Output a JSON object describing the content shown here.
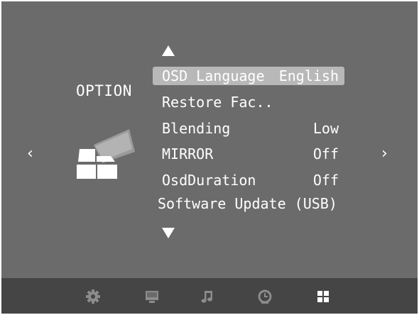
{
  "osd": {
    "section_title": "OPTION",
    "section_icon": "option-icon",
    "left_arrow": "‹",
    "right_arrow": "›",
    "scroll_up_icon": "triangle-up-icon",
    "scroll_down_icon": "triangle-down-icon"
  },
  "menu": {
    "items": [
      {
        "label": "OSD Language",
        "value": "English",
        "selected": true
      },
      {
        "label": "Restore Fac..",
        "value": "",
        "selected": false
      },
      {
        "label": "Blending",
        "value": "Low",
        "selected": false
      },
      {
        "label": "MIRROR",
        "value": "Off",
        "selected": false
      },
      {
        "label": "OsdDuration",
        "value": "Off",
        "selected": false
      },
      {
        "label": "Software Update (USB)",
        "value": "",
        "selected": false
      }
    ]
  },
  "tabs": [
    {
      "name": "settings",
      "icon": "gear-icon",
      "active": false
    },
    {
      "name": "picture",
      "icon": "monitor-icon",
      "active": false
    },
    {
      "name": "sound",
      "icon": "music-note-icon",
      "active": false
    },
    {
      "name": "time",
      "icon": "clock-icon",
      "active": false
    },
    {
      "name": "option",
      "icon": "option-grid-icon",
      "active": true
    }
  ],
  "colors": {
    "background": "#6b6b6b",
    "bottom_bar": "#454545",
    "selection": "#b8b8b8",
    "text": "#ffffff",
    "tab_inactive": "#8c8c8c",
    "tab_active": "#ffffff"
  }
}
